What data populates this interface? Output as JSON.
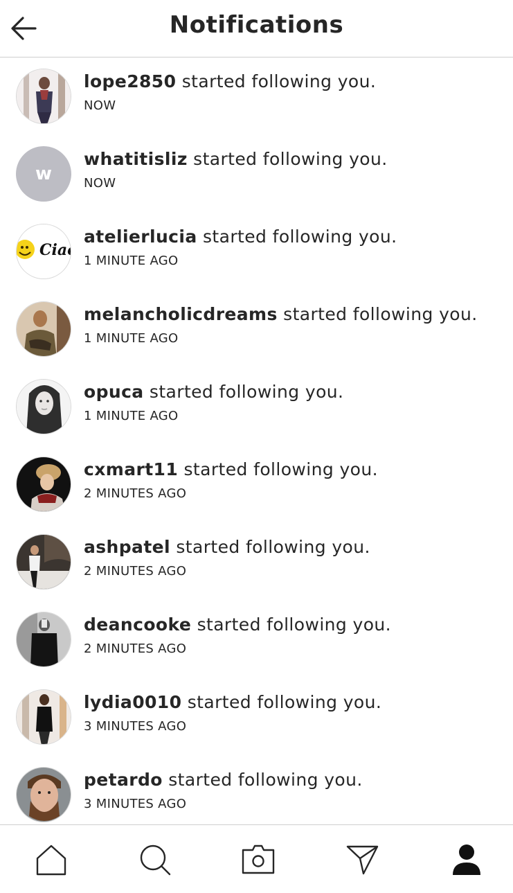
{
  "header": {
    "title": "Notifications",
    "back_icon": "arrow-left-icon"
  },
  "notifications": [
    {
      "username": "lope2850",
      "message": "started following you.",
      "time": "NOW",
      "avatar": "photo"
    },
    {
      "username": "whatitisliz",
      "message": "started following you.",
      "time": "NOW",
      "avatar": "letter",
      "avatar_letter": "w",
      "avatar_color": "#bdbdc4"
    },
    {
      "username": "atelierlucia",
      "message": "started following you.",
      "time": "1 MINUTE AGO",
      "avatar": "logo",
      "avatar_text": "Ciao"
    },
    {
      "username": "melancholicdreams",
      "message": "started following you.",
      "time": "1 MINUTE AGO",
      "avatar": "photo"
    },
    {
      "username": "opuca",
      "message": "started following you.",
      "time": "1 MINUTE AGO",
      "avatar": "photo"
    },
    {
      "username": "cxmart11",
      "message": "started following you.",
      "time": "2 MINUTES AGO",
      "avatar": "photo"
    },
    {
      "username": "ashpatel",
      "message": "started following you.",
      "time": "2 MINUTES AGO",
      "avatar": "photo"
    },
    {
      "username": "deancooke",
      "message": "started following you.",
      "time": "2 MINUTES AGO",
      "avatar": "photo"
    },
    {
      "username": "lydia0010",
      "message": "started following you.",
      "time": "3 MINUTES AGO",
      "avatar": "photo"
    },
    {
      "username": "petardo",
      "message": "started following you.",
      "time": "3 MINUTES AGO",
      "avatar": "photo"
    }
  ],
  "tabbar": {
    "items": [
      {
        "name": "home",
        "icon": "home-icon"
      },
      {
        "name": "search",
        "icon": "search-icon"
      },
      {
        "name": "camera",
        "icon": "camera-icon"
      },
      {
        "name": "direct",
        "icon": "send-icon"
      },
      {
        "name": "profile",
        "icon": "profile-icon",
        "active": true
      }
    ]
  },
  "colors": {
    "text": "#262626",
    "divider": "#cfcfcf",
    "placeholder_avatar": "#bdbdc4"
  }
}
